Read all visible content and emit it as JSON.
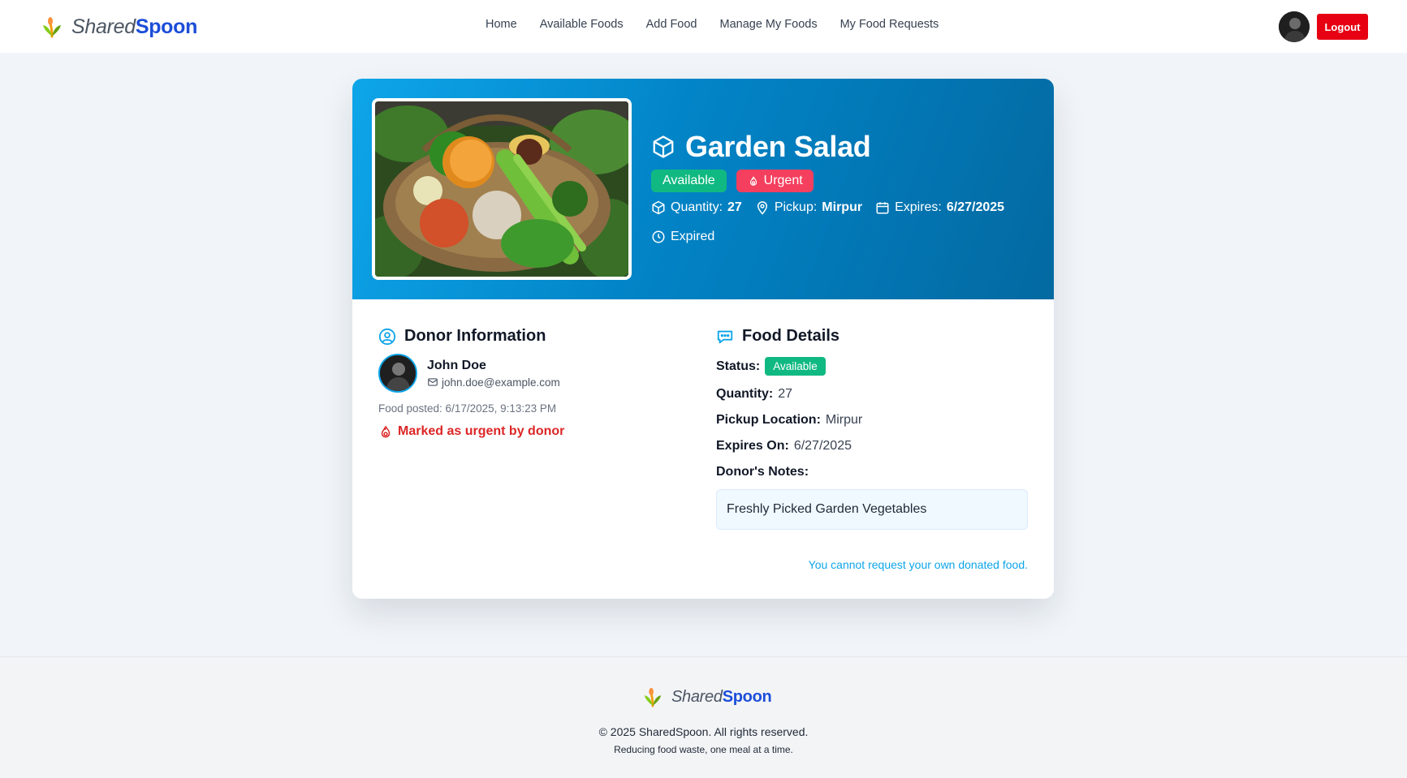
{
  "brand": {
    "part1": "Shared",
    "part2": "Spoon",
    "accent": "#1d4ed8"
  },
  "nav": {
    "links": [
      "Home",
      "Available Foods",
      "Add Food",
      "Manage My Foods",
      "My Food Requests"
    ],
    "logout_label": "Logout"
  },
  "food": {
    "title": "Garden Salad",
    "badge_available": "Available",
    "badge_urgent": "Urgent",
    "quantity_label": "Quantity:",
    "quantity": "27",
    "pickup_label": "Pickup:",
    "pickup": "Mirpur",
    "expires_label": "Expires:",
    "expires": "6/27/2025",
    "expired_text": "Expired"
  },
  "donor": {
    "section_title": "Donor Information",
    "name": "John Doe",
    "email": "john.doe@example.com",
    "posted": "Food posted: 6/17/2025, 9:13:23 PM",
    "urgent_note": "Marked as urgent by donor"
  },
  "details": {
    "section_title": "Food Details",
    "status_label": "Status:",
    "status_value": "Available",
    "quantity_label": "Quantity:",
    "quantity_value": "27",
    "pickup_label": "Pickup Location:",
    "pickup_value": "Mirpur",
    "expires_label": "Expires On:",
    "expires_value": "6/27/2025",
    "notes_label": "Donor's Notes:",
    "notes_value": "Freshly Picked Garden Vegetables",
    "cannot_request": "You cannot request your own donated food."
  },
  "footer": {
    "copyright": "© 2025 SharedSpoon. All rights reserved.",
    "tagline": "Reducing food waste, one meal at a time."
  },
  "colors": {
    "available_green": "#10b981",
    "urgent_pink": "#f43f5e",
    "logout_red": "#e60012",
    "hero_gradient_start": "#0ea5e9",
    "hero_gradient_end": "#0369a1"
  }
}
